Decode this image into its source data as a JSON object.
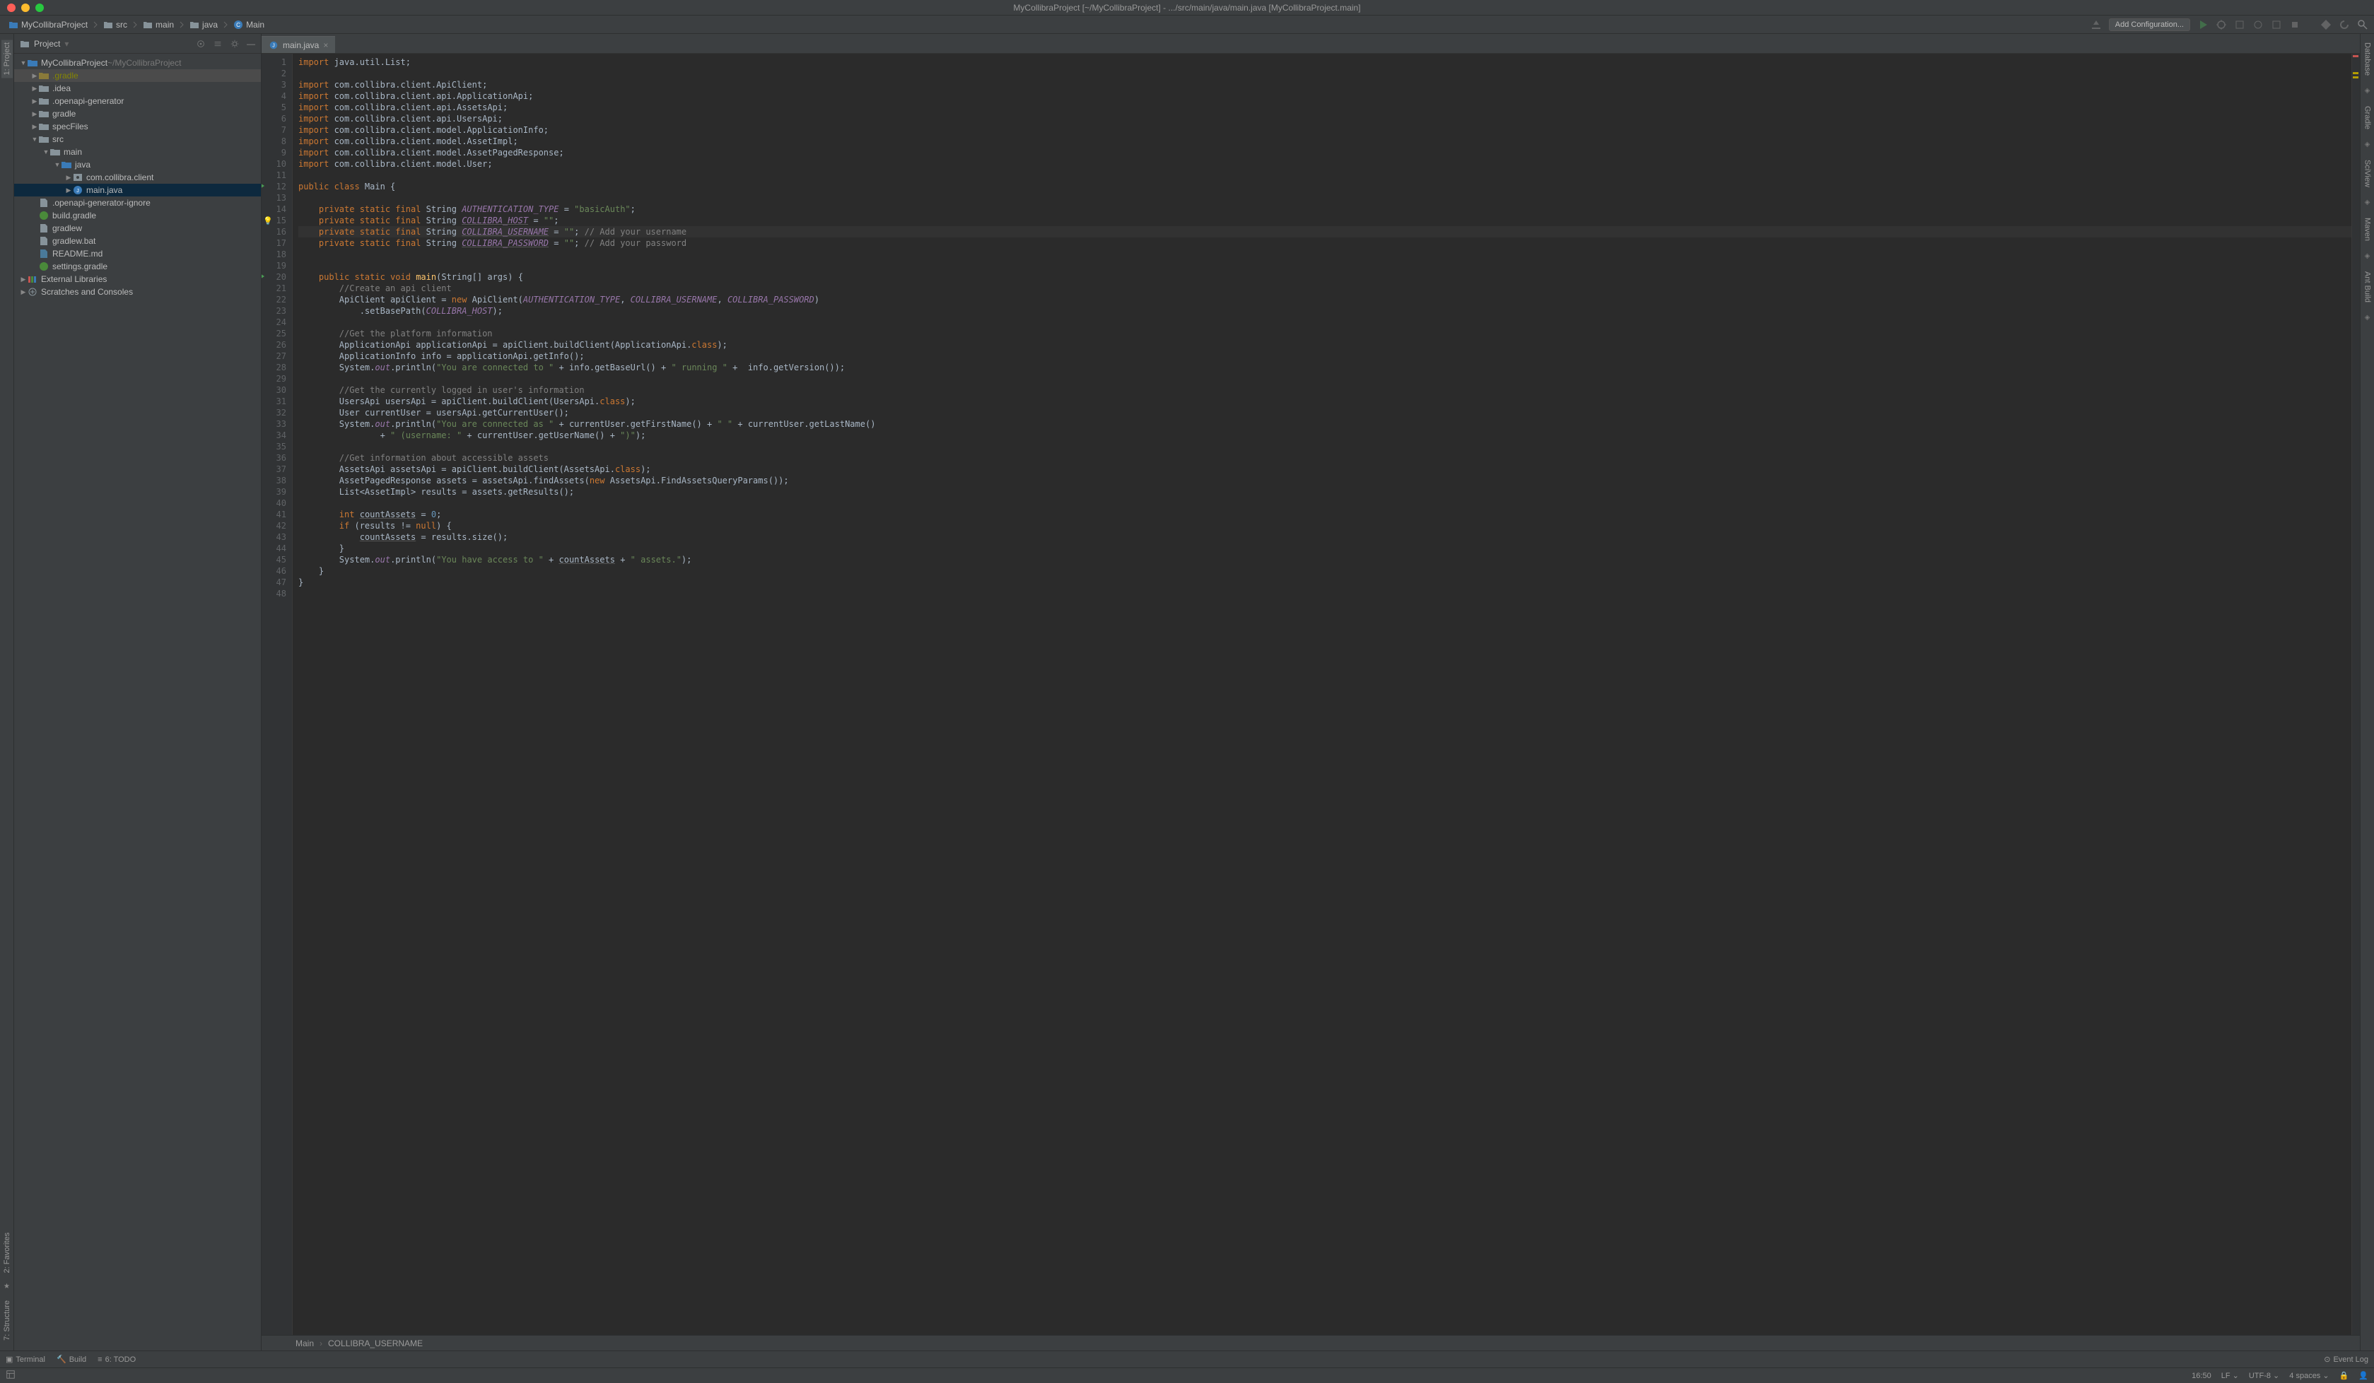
{
  "window_title": "MyCollibraProject [~/MyCollibraProject] - .../src/main/java/main.java [MyCollibraProject.main]",
  "breadcrumbs": [
    {
      "label": "MyCollibraProject",
      "type": "module"
    },
    {
      "label": "src",
      "type": "folder"
    },
    {
      "label": "main",
      "type": "folder"
    },
    {
      "label": "java",
      "type": "folder"
    },
    {
      "label": "Main",
      "type": "class"
    }
  ],
  "toolbar": {
    "add_config": "Add Configuration..."
  },
  "sidebar": {
    "title": "Project",
    "root": {
      "name": "MyCollibraProject",
      "path": "~/MyCollibraProject"
    },
    "nodes": [
      {
        "depth": 0,
        "arrow": "▼",
        "icon": "module",
        "label": "MyCollibraProject",
        "suffix": " ~/MyCollibraProject",
        "dimSuffix": true
      },
      {
        "depth": 1,
        "arrow": "▶",
        "icon": "folder-ex",
        "label": ".gradle",
        "excluded": true,
        "highlight": true
      },
      {
        "depth": 1,
        "arrow": "▶",
        "icon": "folder",
        "label": ".idea"
      },
      {
        "depth": 1,
        "arrow": "▶",
        "icon": "folder",
        "label": ".openapi-generator"
      },
      {
        "depth": 1,
        "arrow": "▶",
        "icon": "folder",
        "label": "gradle"
      },
      {
        "depth": 1,
        "arrow": "▶",
        "icon": "folder",
        "label": "specFiles"
      },
      {
        "depth": 1,
        "arrow": "▼",
        "icon": "folder",
        "label": "src"
      },
      {
        "depth": 2,
        "arrow": "▼",
        "icon": "folder",
        "label": "main"
      },
      {
        "depth": 3,
        "arrow": "▼",
        "icon": "src-folder",
        "label": "java"
      },
      {
        "depth": 4,
        "arrow": "▶",
        "icon": "package",
        "label": "com.collibra.client"
      },
      {
        "depth": 4,
        "arrow": "▶",
        "icon": "jfile",
        "label": "main.java",
        "selected": true
      },
      {
        "depth": 1,
        "arrow": "",
        "icon": "file",
        "label": ".openapi-generator-ignore"
      },
      {
        "depth": 1,
        "arrow": "",
        "icon": "gradle",
        "label": "build.gradle"
      },
      {
        "depth": 1,
        "arrow": "",
        "icon": "file",
        "label": "gradlew"
      },
      {
        "depth": 1,
        "arrow": "",
        "icon": "file",
        "label": "gradlew.bat"
      },
      {
        "depth": 1,
        "arrow": "",
        "icon": "md",
        "label": "README.md"
      },
      {
        "depth": 1,
        "arrow": "",
        "icon": "gradle",
        "label": "settings.gradle"
      },
      {
        "depth": 0,
        "arrow": "▶",
        "icon": "lib",
        "label": "External Libraries"
      },
      {
        "depth": 0,
        "arrow": "▶",
        "icon": "scratch",
        "label": "Scratches and Consoles"
      }
    ]
  },
  "left_tool_tabs": [
    {
      "label": "1: Project",
      "active": true
    },
    {
      "label": "2: Favorites"
    },
    {
      "label": "7: Structure"
    }
  ],
  "right_tool_tabs": [
    {
      "label": "Database"
    },
    {
      "label": "Gradle"
    },
    {
      "label": "SciView"
    },
    {
      "label": "Maven"
    },
    {
      "label": "Ant Build"
    }
  ],
  "editor_tab": "main.java",
  "code_lines": [
    {
      "n": 1,
      "html": "<span class='kw'>import</span> java.util.List;"
    },
    {
      "n": 2,
      "html": ""
    },
    {
      "n": 3,
      "html": "<span class='kw'>import</span> com.collibra.client.ApiClient;"
    },
    {
      "n": 4,
      "html": "<span class='kw'>import</span> com.collibra.client.api.ApplicationApi;"
    },
    {
      "n": 5,
      "html": "<span class='kw'>import</span> com.collibra.client.api.AssetsApi;"
    },
    {
      "n": 6,
      "html": "<span class='kw'>import</span> com.collibra.client.api.UsersApi;"
    },
    {
      "n": 7,
      "html": "<span class='kw'>import</span> com.collibra.client.model.ApplicationInfo;"
    },
    {
      "n": 8,
      "html": "<span class='kw'>import</span> com.collibra.client.model.AssetImpl;"
    },
    {
      "n": 9,
      "html": "<span class='kw'>import</span> com.collibra.client.model.AssetPagedResponse;"
    },
    {
      "n": 10,
      "html": "<span class='kw'>import</span> com.collibra.client.model.User;"
    },
    {
      "n": 11,
      "html": ""
    },
    {
      "n": 12,
      "html": "<span class='kw'>public class</span> Main {",
      "run": true
    },
    {
      "n": 13,
      "html": ""
    },
    {
      "n": 14,
      "html": "    <span class='kw'>private static final</span> String <span class='fld'>AUTHENTICATION_TYPE</span> = <span class='st'>\"basicAuth\"</span>;"
    },
    {
      "n": 15,
      "html": "    <span class='kw'>private static final</span> String <span class='fld under'>COLLIBRA_HOST</span> = <span class='st'>\"\"</span>;",
      "bulb": true
    },
    {
      "n": 16,
      "html": "    <span class='kw'>private static final</span> String <span class='fld under'>COLLIBRA_USERNAME</span> = <span class='st'>\"\"</span>; <span class='cm'>// Add your username</span>",
      "caret": true
    },
    {
      "n": 17,
      "html": "    <span class='kw'>private static final</span> String <span class='fld under'>COLLIBRA_PASSWORD</span> = <span class='st'>\"\"</span>; <span class='cm'>// Add your password</span>"
    },
    {
      "n": 18,
      "html": ""
    },
    {
      "n": 19,
      "html": ""
    },
    {
      "n": 20,
      "html": "    <span class='kw'>public static void</span> <span class='fn'>main</span>(String[] args) {",
      "run": true
    },
    {
      "n": 21,
      "html": "        <span class='cm'>//Create an api client</span>"
    },
    {
      "n": 22,
      "html": "        ApiClient apiClient = <span class='kw'>new</span> ApiClient(<span class='fld'>AUTHENTICATION_TYPE</span>, <span class='fld'>COLLIBRA_USERNAME</span>, <span class='fld'>COLLIBRA_PASSWORD</span>)"
    },
    {
      "n": 23,
      "html": "            .setBasePath(<span class='fld'>COLLIBRA_HOST</span>);"
    },
    {
      "n": 24,
      "html": ""
    },
    {
      "n": 25,
      "html": "        <span class='cm'>//Get the platform information</span>"
    },
    {
      "n": 26,
      "html": "        ApplicationApi applicationApi = apiClient.buildClient(ApplicationApi.<span class='kw'>class</span>);"
    },
    {
      "n": 27,
      "html": "        ApplicationInfo info = applicationApi.getInfo();"
    },
    {
      "n": 28,
      "html": "        System.<span class='fld'>out</span>.println(<span class='st'>\"You are connected to \"</span> + info.getBaseUrl() + <span class='st'>\" running \"</span> +  info.getVersion());"
    },
    {
      "n": 29,
      "html": ""
    },
    {
      "n": 30,
      "html": "        <span class='cm'>//Get the currently logged in user's information</span>"
    },
    {
      "n": 31,
      "html": "        UsersApi usersApi = apiClient.buildClient(UsersApi.<span class='kw'>class</span>);"
    },
    {
      "n": 32,
      "html": "        User currentUser = usersApi.getCurrentUser();"
    },
    {
      "n": 33,
      "html": "        System.<span class='fld'>out</span>.println(<span class='st'>\"You are connected as \"</span> + currentUser.getFirstName() + <span class='st'>\" \"</span> + currentUser.getLastName()"
    },
    {
      "n": 34,
      "html": "                + <span class='st'>\" (username: \"</span> + currentUser.getUserName() + <span class='st'>\")\"</span>);"
    },
    {
      "n": 35,
      "html": ""
    },
    {
      "n": 36,
      "html": "        <span class='cm'>//Get information about accessible assets</span>"
    },
    {
      "n": 37,
      "html": "        AssetsApi assetsApi = apiClient.buildClient(AssetsApi.<span class='kw'>class</span>);"
    },
    {
      "n": 38,
      "html": "        AssetPagedResponse assets = assetsApi.findAssets(<span class='kw'>new</span> AssetsApi.FindAssetsQueryParams());"
    },
    {
      "n": 39,
      "html": "        List&lt;AssetImpl&gt; results = assets.getResults();"
    },
    {
      "n": 40,
      "html": ""
    },
    {
      "n": 41,
      "html": "        <span class='kw'>int</span> <span class='under'>countAssets</span> = <span class='num'>0</span>;"
    },
    {
      "n": 42,
      "html": "        <span class='kw'>if</span> (results != <span class='kw'>null</span>) {"
    },
    {
      "n": 43,
      "html": "            <span class='under'>countAssets</span> = results.size();"
    },
    {
      "n": 44,
      "html": "        }"
    },
    {
      "n": 45,
      "html": "        System.<span class='fld'>out</span>.println(<span class='st'>\"You have access to \"</span> + <span class='under'>countAssets</span> + <span class='st'>\" assets.\"</span>);"
    },
    {
      "n": 46,
      "html": "    }"
    },
    {
      "n": 47,
      "html": "}"
    },
    {
      "n": 48,
      "html": ""
    }
  ],
  "crumb_trail": [
    "Main",
    "COLLIBRA_USERNAME"
  ],
  "bottom_tabs": [
    {
      "label": "Terminal",
      "icon": "▣"
    },
    {
      "label": "Build",
      "icon": "🔨"
    },
    {
      "label": "6: TODO",
      "icon": "≡"
    }
  ],
  "event_log": "Event Log",
  "status": {
    "line_col": "16:50",
    "sep": "LF",
    "encoding": "UTF-8",
    "indent": "4 spaces"
  }
}
